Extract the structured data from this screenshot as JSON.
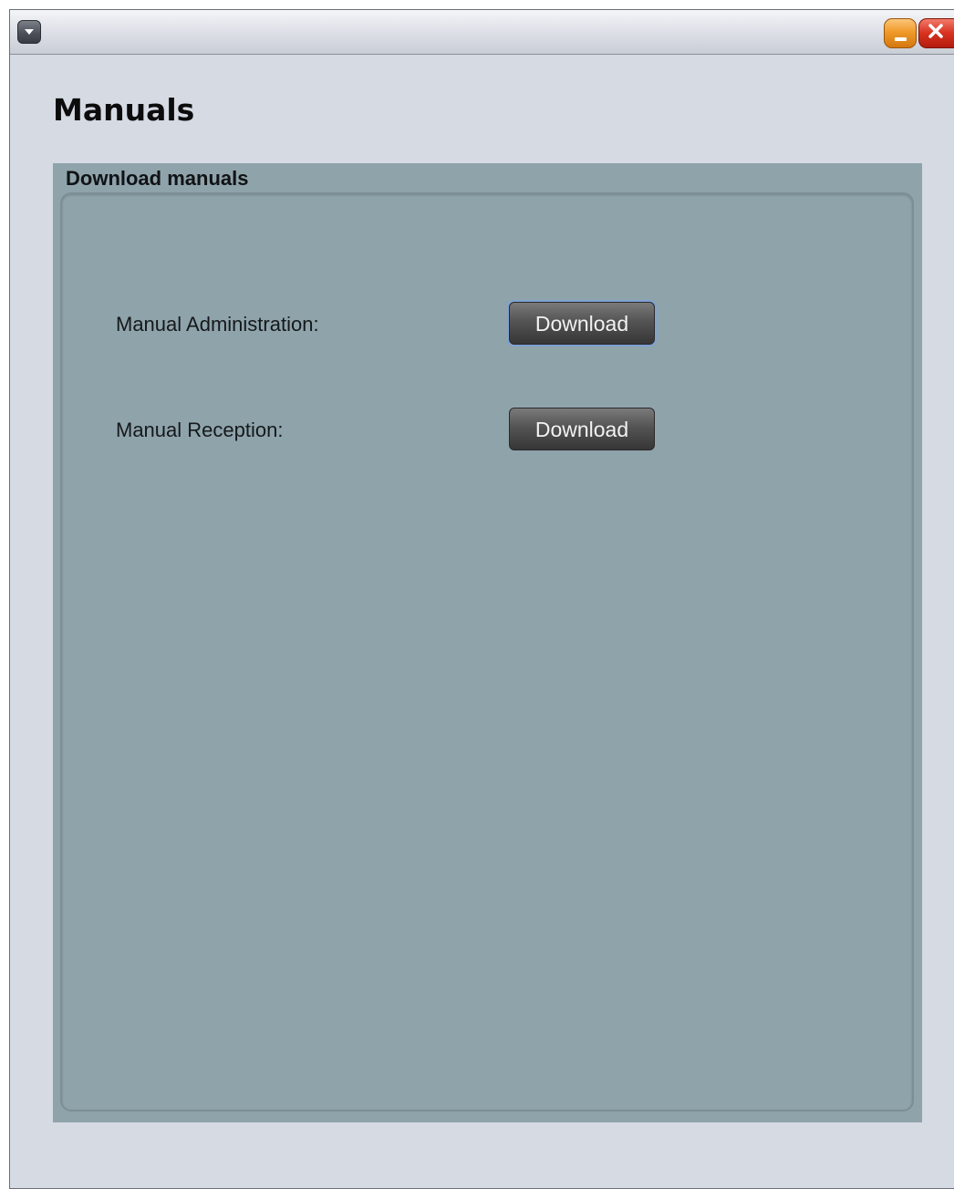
{
  "window": {
    "title": "",
    "accent_color": "#8fa3ab",
    "minimize_color": "#f09a2a",
    "close_color": "#d8311f"
  },
  "page": {
    "title": "Manuals"
  },
  "group": {
    "title": "Download manuals",
    "rows": [
      {
        "label": "Manual Administration:",
        "button_label": "Download",
        "focused": true
      },
      {
        "label": "Manual Reception:",
        "button_label": "Download",
        "focused": false
      }
    ]
  },
  "icons": {
    "menu": "chevron-down-icon",
    "minimize": "minimize-icon",
    "close": "close-icon"
  }
}
